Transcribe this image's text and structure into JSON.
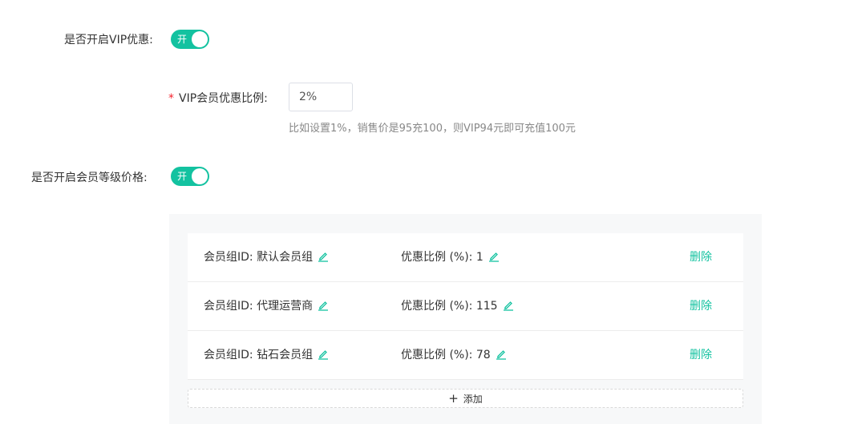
{
  "vip": {
    "label": "是否开启VIP优惠:",
    "switch_text": "开"
  },
  "vip_ratio": {
    "required_mark": "*",
    "label": "VIP会员优惠比例:",
    "value": "2%",
    "hint": "比如设置1%，销售价是95充100，则VIP94元即可充值100元"
  },
  "level_price": {
    "label": "是否开启会员等级价格:",
    "switch_text": "开"
  },
  "groups": [
    {
      "id_label": "会员组ID:",
      "name": "默认会员组",
      "ratio_label": "优惠比例 (%):",
      "ratio": "1",
      "delete": "删除"
    },
    {
      "id_label": "会员组ID:",
      "name": "代理运营商",
      "ratio_label": "优惠比例 (%):",
      "ratio": "115",
      "delete": "删除"
    },
    {
      "id_label": "会员组ID:",
      "name": "钻石会员组",
      "ratio_label": "优惠比例 (%):",
      "ratio": "78",
      "delete": "删除"
    }
  ],
  "add_button": {
    "icon": "plus-icon",
    "label": "添加"
  },
  "colors": {
    "accent": "#13c2a0",
    "required": "#f5222d"
  }
}
